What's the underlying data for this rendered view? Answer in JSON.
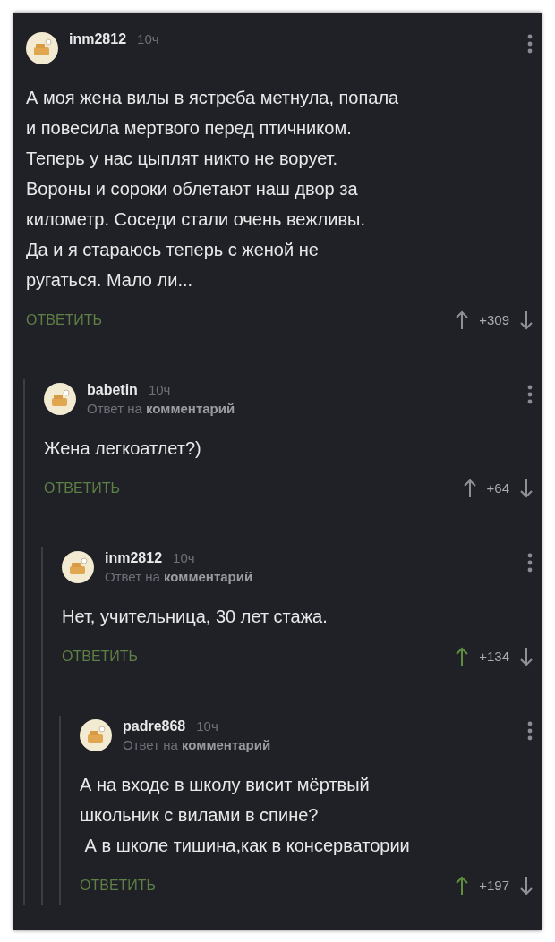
{
  "comments": [
    {
      "author": "inm2812",
      "time": "10ч",
      "text": "А моя жена вилы в ястреба метнула, попала\nи повесила мертвого перед птичником.\nТеперь у нас цыплят никто не ворует.\nВороны и сороки облетают наш двор за\nкилометр. Соседи стали очень вежливы.\nДа и я стараюсь теперь с женой не\nругаться. Мало ли...",
      "reply": "ОТВЕТИТЬ",
      "score": "+309",
      "upvoted": false,
      "children": [
        {
          "author": "babetin",
          "time": "10ч",
          "reply_to": "Ответ на **комментарий**",
          "text": "Жена легкоатлет?)",
          "reply": "ОТВЕТИТЬ",
          "score": "+64",
          "upvoted": false,
          "children": [
            {
              "author": "inm2812",
              "time": "10ч",
              "reply_to": "Ответ на **комментарий**",
              "text": "Нет, учительница, 30 лет стажа.",
              "reply": "ОТВЕТИТЬ",
              "score": "+134",
              "upvoted": true,
              "children": [
                {
                  "author": "padre868",
                  "time": "10ч",
                  "reply_to": "Ответ на **комментарий**",
                  "text": "А на входе в школу висит мёртвый\nшкольник с вилами в спине?\n А в школе тишина,как в консерватории",
                  "reply": "ОТВЕТИТЬ",
                  "score": "+197",
                  "upvoted": true
                }
              ]
            }
          ]
        }
      ]
    }
  ]
}
